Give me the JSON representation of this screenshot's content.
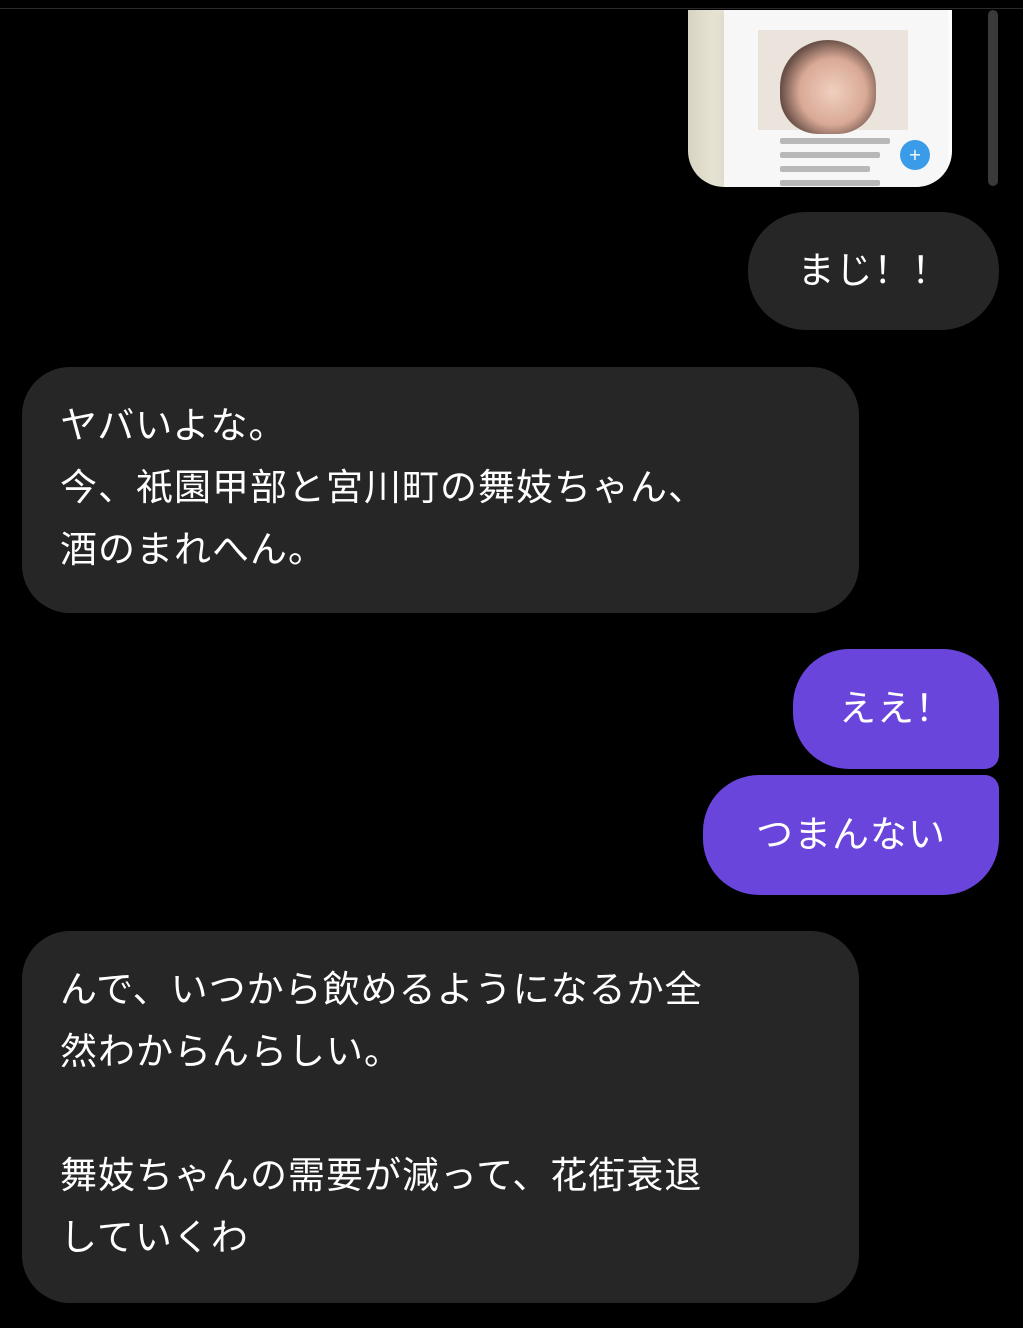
{
  "colors": {
    "background": "#000000",
    "bubble_gray": "#262626",
    "bubble_purple": "#6a45dc"
  },
  "shared_image": {
    "icon": "image-thumbnail"
  },
  "messages": [
    {
      "id": "b1",
      "sender": "me",
      "text": "まじ！！"
    },
    {
      "id": "b2",
      "sender": "them",
      "text": "ヤバいよな。\n今、祇園甲部と宮川町の舞妓ちゃん、\n酒のまれへん。"
    },
    {
      "id": "b3",
      "sender": "me",
      "text": "ええ！"
    },
    {
      "id": "b4",
      "sender": "me",
      "text": "つまんない"
    },
    {
      "id": "b5",
      "sender": "them",
      "text": "んで、いつから飲めるようになるか全\n然わからんらしい。\n\n舞妓ちゃんの需要が減って、花街衰退\nしていくわ"
    }
  ]
}
